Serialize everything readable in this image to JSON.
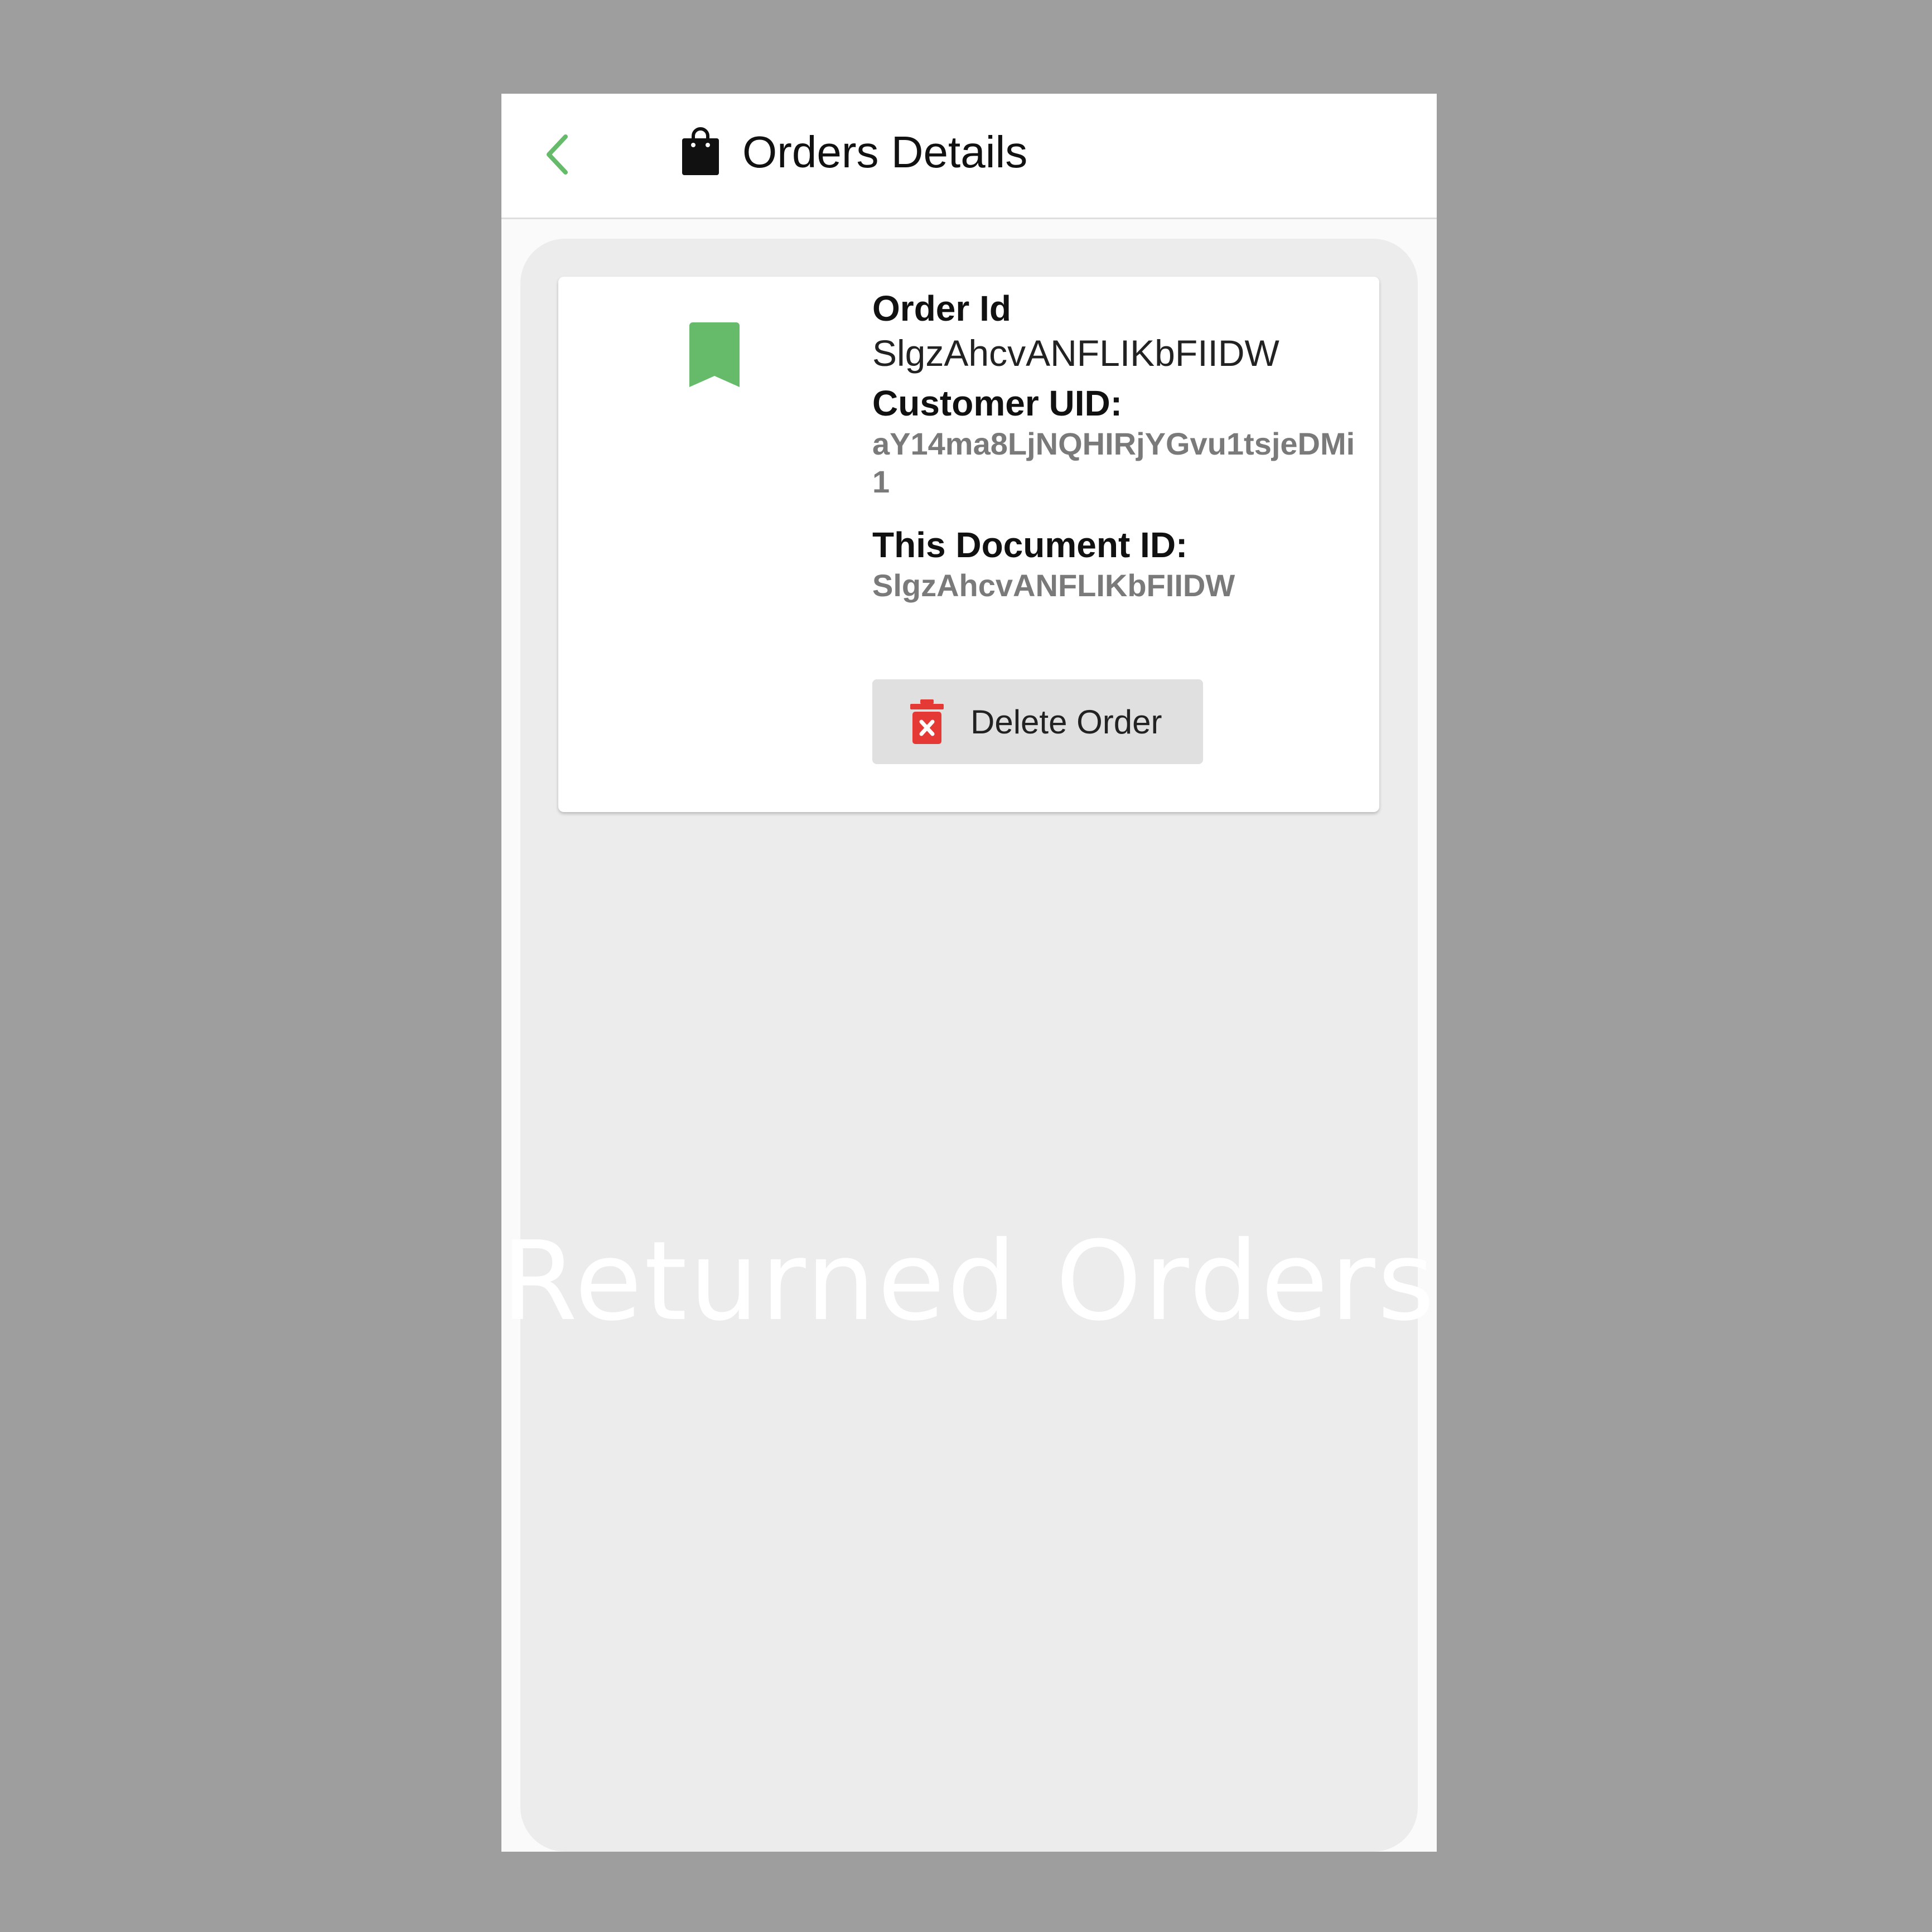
{
  "appbar": {
    "title": "Orders Details",
    "back_icon": "chevron-left-icon",
    "title_icon": "shopping-bag-icon",
    "accent_color": "#66bb6a"
  },
  "order": {
    "order_id_label": "Order Id",
    "order_id_value": "SlgzAhcvANFLIKbFIIDW",
    "customer_uid_label": "Customer UID:",
    "customer_uid_value": "aY14ma8LjNQHIRjYGvu1tsjeDMi1",
    "document_id_label": "This Document ID:",
    "document_id_value": "SlgzAhcvANFLIKbFIIDW",
    "bookmark_icon": "bookmark-icon",
    "bookmark_color": "#66bb6a"
  },
  "actions": {
    "delete_label": "Delete Order",
    "delete_icon": "trash-icon",
    "delete_icon_color": "#e53935"
  },
  "background_text": "Returned Orders"
}
